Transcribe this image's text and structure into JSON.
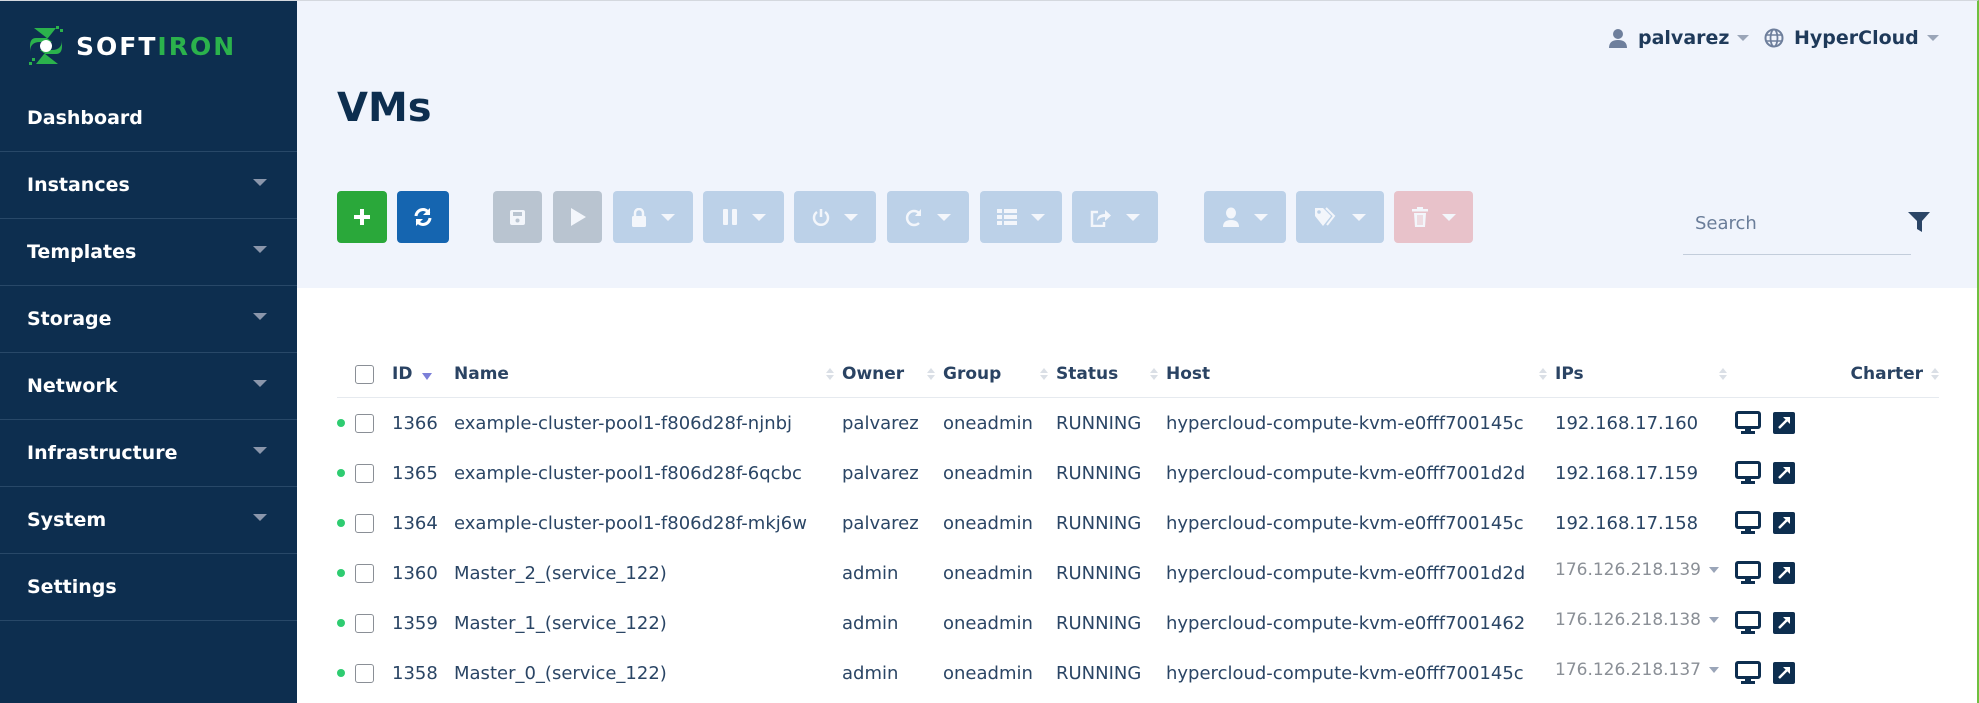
{
  "brand": {
    "part1": "SOFT",
    "part2": "IRON",
    "accent": "#2bb24c",
    "sidebar_bg": "#0d2e4f"
  },
  "sidebar": {
    "items": [
      {
        "label": "Dashboard",
        "has_submenu": false
      },
      {
        "label": "Instances",
        "has_submenu": true
      },
      {
        "label": "Templates",
        "has_submenu": true
      },
      {
        "label": "Storage",
        "has_submenu": true
      },
      {
        "label": "Network",
        "has_submenu": true
      },
      {
        "label": "Infrastructure",
        "has_submenu": true
      },
      {
        "label": "System",
        "has_submenu": true
      },
      {
        "label": "Settings",
        "has_submenu": false
      }
    ]
  },
  "header": {
    "user": "palvarez",
    "zone": "HyperCloud",
    "title": "VMs"
  },
  "toolbar": {
    "buttons": [
      {
        "icon": "plus-icon",
        "state": "enabled",
        "color": "#2aa83a"
      },
      {
        "icon": "refresh-icon",
        "state": "enabled",
        "color": "#1565b0"
      },
      {
        "icon": "save-icon",
        "state": "disabled"
      },
      {
        "icon": "play-icon",
        "state": "disabled"
      },
      {
        "icon": "lock-icon",
        "state": "disabled",
        "dropdown": true
      },
      {
        "icon": "pause-icon",
        "state": "disabled",
        "dropdown": true
      },
      {
        "icon": "power-icon",
        "state": "disabled",
        "dropdown": true
      },
      {
        "icon": "reboot-icon",
        "state": "disabled",
        "dropdown": true
      },
      {
        "icon": "list-icon",
        "state": "disabled",
        "dropdown": true
      },
      {
        "icon": "share-icon",
        "state": "disabled",
        "dropdown": true
      },
      {
        "icon": "user-icon",
        "state": "disabled",
        "dropdown": true
      },
      {
        "icon": "tags-icon",
        "state": "disabled",
        "dropdown": true
      },
      {
        "icon": "trash-icon",
        "state": "disabled",
        "dropdown": true
      }
    ],
    "search_placeholder": "Search"
  },
  "table": {
    "columns": [
      "ID",
      "Name",
      "Owner",
      "Group",
      "Status",
      "Host",
      "IPs",
      "",
      "Charter"
    ],
    "sorted_by": "ID",
    "sort_direction": "desc",
    "rows": [
      {
        "id": "1366",
        "name": "example-cluster-pool1-f806d28f-njnbj",
        "owner": "palvarez",
        "group": "oneadmin",
        "status": "RUNNING",
        "host": "hypercloud-compute-kvm-e0fff700145c",
        "ip": "192.168.17.160",
        "ip_dropdown": false
      },
      {
        "id": "1365",
        "name": "example-cluster-pool1-f806d28f-6qcbc",
        "owner": "palvarez",
        "group": "oneadmin",
        "status": "RUNNING",
        "host": "hypercloud-compute-kvm-e0fff7001d2d",
        "ip": "192.168.17.159",
        "ip_dropdown": false
      },
      {
        "id": "1364",
        "name": "example-cluster-pool1-f806d28f-mkj6w",
        "owner": "palvarez",
        "group": "oneadmin",
        "status": "RUNNING",
        "host": "hypercloud-compute-kvm-e0fff700145c",
        "ip": "192.168.17.158",
        "ip_dropdown": false
      },
      {
        "id": "1360",
        "name": "Master_2_(service_122)",
        "owner": "admin",
        "group": "oneadmin",
        "status": "RUNNING",
        "host": "hypercloud-compute-kvm-e0fff7001d2d",
        "ip": "176.126.218.139",
        "ip_dropdown": true
      },
      {
        "id": "1359",
        "name": "Master_1_(service_122)",
        "owner": "admin",
        "group": "oneadmin",
        "status": "RUNNING",
        "host": "hypercloud-compute-kvm-e0fff7001462",
        "ip": "176.126.218.138",
        "ip_dropdown": true
      },
      {
        "id": "1358",
        "name": "Master_0_(service_122)",
        "owner": "admin",
        "group": "oneadmin",
        "status": "RUNNING",
        "host": "hypercloud-compute-kvm-e0fff700145c",
        "ip": "176.126.218.137",
        "ip_dropdown": true
      }
    ],
    "status_color": "#2ecc71"
  }
}
